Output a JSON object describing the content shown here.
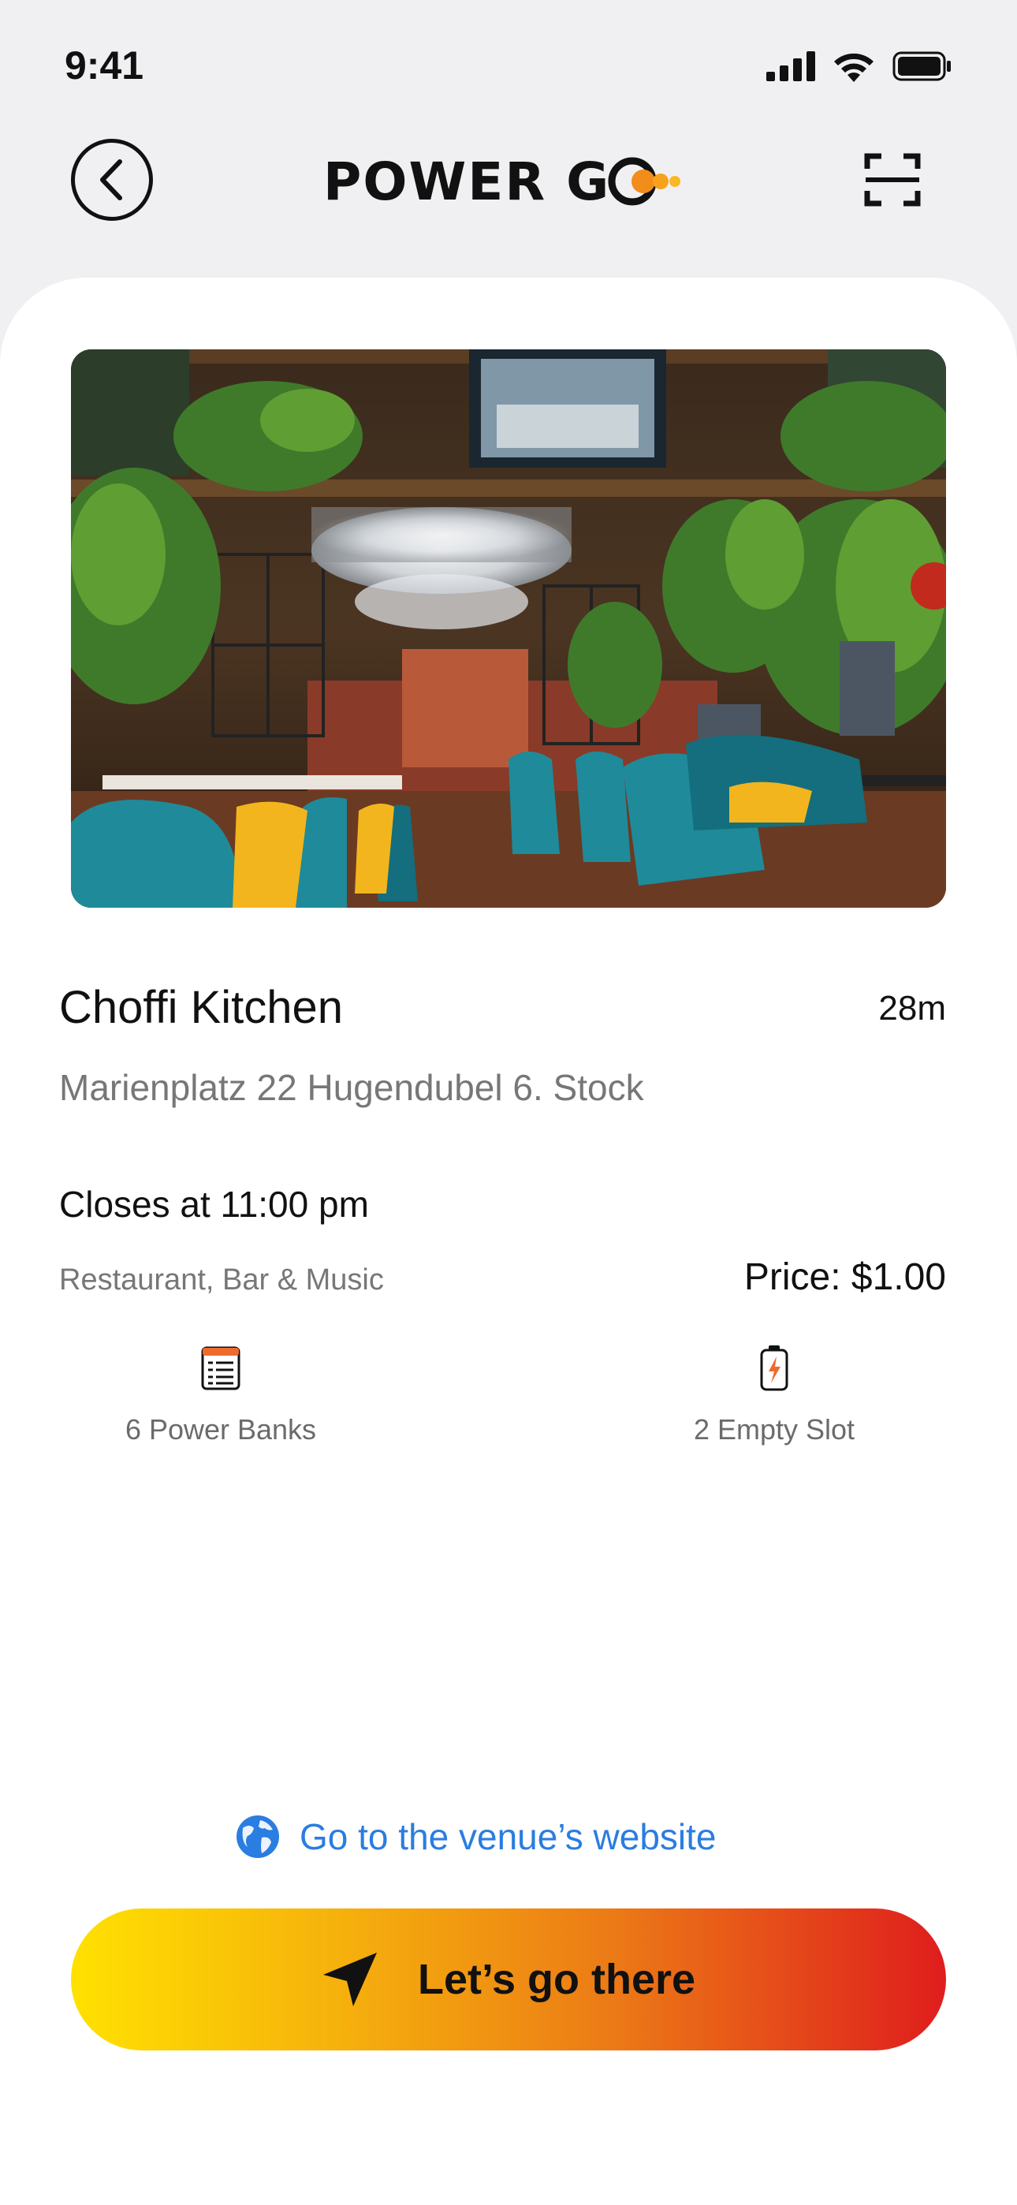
{
  "status_bar": {
    "time": "9:41"
  },
  "header": {
    "logo_text": "POWER G"
  },
  "venue": {
    "name": "Choffi Kitchen",
    "distance": "28m",
    "address": "Marienplatz 22 Hugendubel 6. Stock",
    "hours": "Closes at 11:00 pm",
    "category": "Restaurant, Bar & Music",
    "price": "Price: $1.00"
  },
  "stats": {
    "power_banks": "6 Power Banks",
    "empty_slots": "2 Empty Slot"
  },
  "actions": {
    "website_link": "Go to the venue’s website",
    "go_button": "Let’s go there"
  },
  "colors": {
    "accent_blue": "#2a7de1",
    "gradient_start": "#ffe100",
    "gradient_end": "#df1d1d",
    "logo_orange": "#f28c1b"
  },
  "icons": {
    "back": "chevron-left-icon",
    "scan": "scan-icon",
    "power_banks": "list-icon",
    "empty_slots": "battery-icon",
    "website": "globe-icon",
    "navigate": "navigation-arrow-icon"
  }
}
